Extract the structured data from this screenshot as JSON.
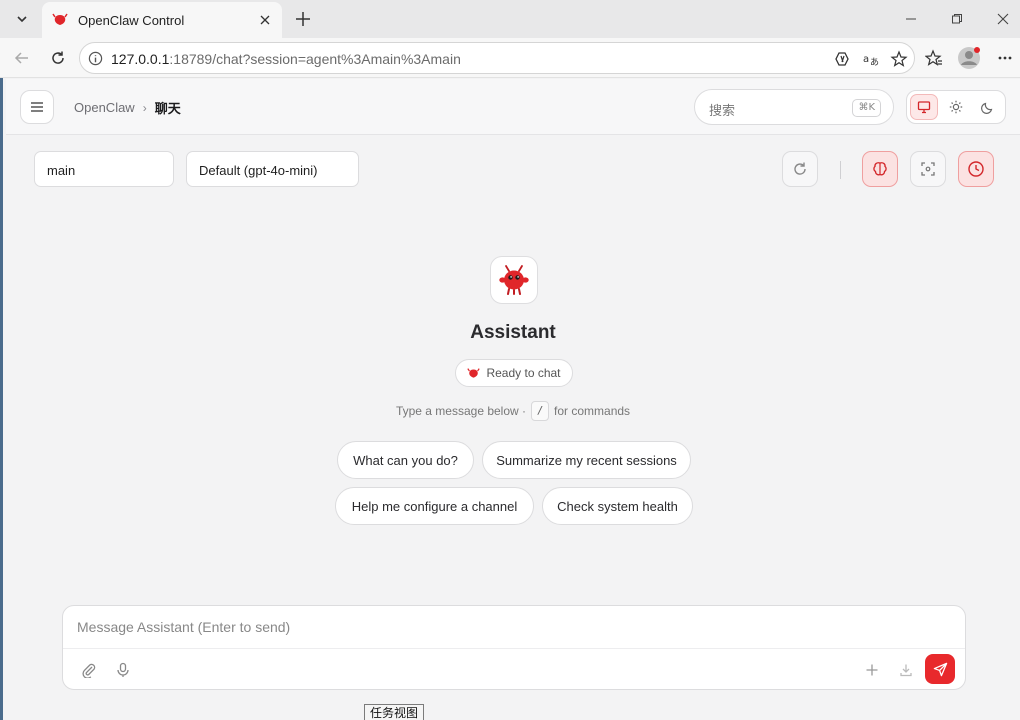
{
  "browser": {
    "tab_title": "OpenClaw Control",
    "url_host": "127.0.0.1",
    "url_rest": ":18789/chat?session=agent%3Amain%3Amain"
  },
  "header": {
    "breadcrumb_root": "OpenClaw",
    "breadcrumb_sep": "›",
    "breadcrumb_current": "聊天",
    "search_placeholder": "搜索",
    "search_shortcut": "⌘K"
  },
  "controls": {
    "session_value": "main",
    "model_value": "Default (gpt-4o-mini)"
  },
  "welcome": {
    "assistant_name": "Assistant",
    "status": "Ready to chat",
    "hint_before": "Type a message below ·",
    "hint_key": "/",
    "hint_after": "for commands",
    "suggestions": [
      "What can you do?",
      "Summarize my recent sessions",
      "Help me configure a channel",
      "Check system health"
    ]
  },
  "composer": {
    "placeholder": "Message Assistant (Enter to send)"
  },
  "os": {
    "tooltip": "任务视图"
  },
  "colors": {
    "accent": "#e8292c",
    "accent_soft": "#fbe2e2"
  }
}
